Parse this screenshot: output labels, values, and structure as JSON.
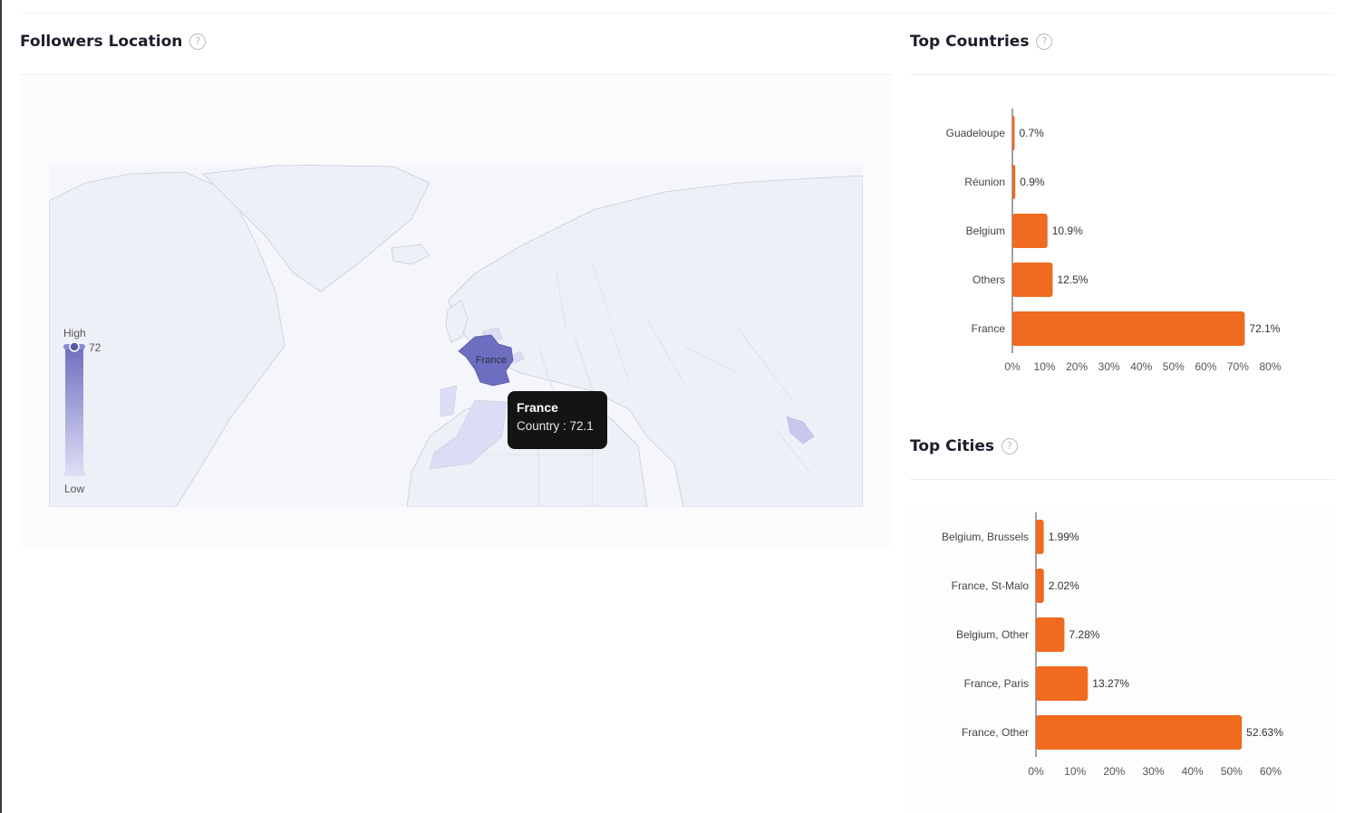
{
  "followers_location": {
    "title": "Followers Location",
    "help_icon": "?",
    "legend": {
      "high_label": "High",
      "low_label": "Low",
      "max_value": "72"
    },
    "map_label": "France",
    "tooltip": {
      "title": "France",
      "text": "Country : 72.1"
    }
  },
  "colors": {
    "bar": "#f06a1f",
    "map_high": "#6e6ec0",
    "map_low": "#dcdcf4",
    "map_base": "#eef0f8"
  },
  "chart_data": [
    {
      "id": "top-countries",
      "type": "bar",
      "orientation": "horizontal",
      "title": "Top Countries",
      "categories": [
        "Guadeloupe",
        "Réunion",
        "Belgium",
        "Others",
        "France"
      ],
      "values": [
        0.7,
        0.9,
        10.9,
        12.5,
        72.1
      ],
      "value_labels": [
        "0.7%",
        "0.9%",
        "10.9%",
        "12.5%",
        "72.1%"
      ],
      "xlim": [
        0,
        80
      ],
      "ticks": [
        "0%",
        "10%",
        "20%",
        "30%",
        "40%",
        "50%",
        "60%",
        "70%",
        "80%"
      ],
      "grid": false
    },
    {
      "id": "top-cities",
      "type": "bar",
      "orientation": "horizontal",
      "title": "Top Cities",
      "categories": [
        "Belgium, Brussels",
        "France, St-Malo",
        "Belgium, Other",
        "France, Paris",
        "France, Other"
      ],
      "values": [
        1.99,
        2.02,
        7.28,
        13.27,
        52.63
      ],
      "value_labels": [
        "1.99%",
        "2.02%",
        "7.28%",
        "13.27%",
        "52.63%"
      ],
      "xlim": [
        0,
        60
      ],
      "ticks": [
        "0%",
        "10%",
        "20%",
        "30%",
        "40%",
        "50%",
        "60%"
      ],
      "grid": false
    }
  ]
}
